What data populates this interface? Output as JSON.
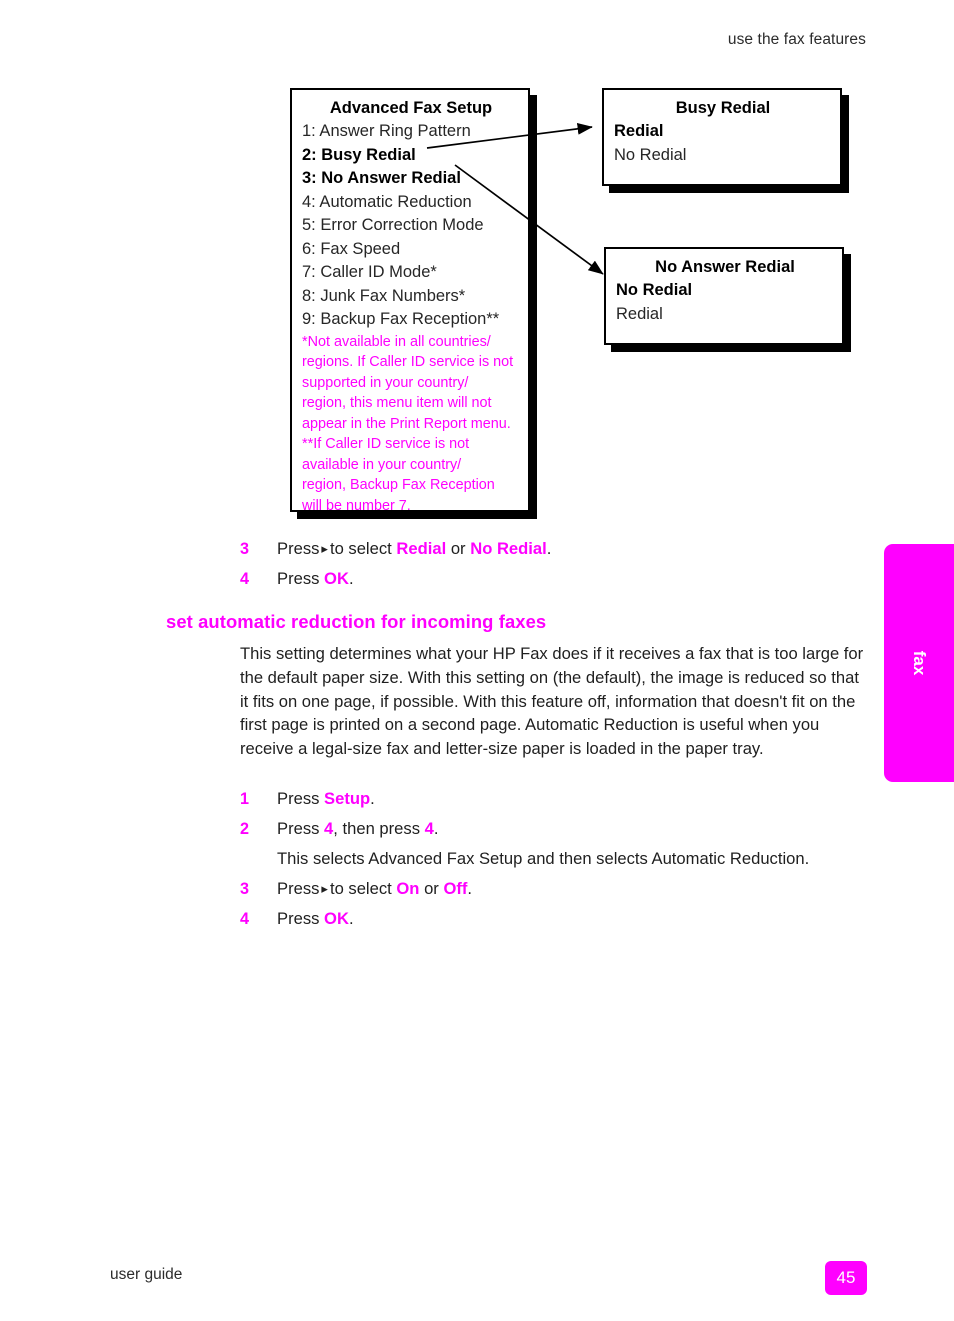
{
  "header": {
    "running_head": "use the fax features"
  },
  "diagram": {
    "advanced_box": {
      "title": "Advanced Fax Setup",
      "items": [
        {
          "label": "1: Answer Ring Pattern",
          "bold": false
        },
        {
          "label": "2: Busy Redial",
          "bold": true
        },
        {
          "label": "3: No Answer Redial",
          "bold": true
        },
        {
          "label": "4: Automatic Reduction",
          "bold": false
        },
        {
          "label": "5: Error Correction Mode",
          "bold": false
        },
        {
          "label": "6: Fax Speed",
          "bold": false
        },
        {
          "label": "7: Caller ID Mode*",
          "bold": false
        },
        {
          "label": "8: Junk Fax Numbers*",
          "bold": false
        },
        {
          "label": "9: Backup Fax Reception**",
          "bold": false
        }
      ],
      "footnotes": [
        "*Not available in all countries/",
        "regions. If Caller ID service is not",
        "supported in your country/",
        "region, this menu item will not",
        "appear in the Print Report menu.",
        "**If Caller ID service is not",
        "available in your country/",
        "region, Backup Fax Reception",
        "will be number 7."
      ]
    },
    "busy_redial_box": {
      "title": "Busy Redial",
      "option_selected": "Redial",
      "option_other": "No Redial"
    },
    "no_answer_redial_box": {
      "title": "No Answer Redial",
      "option_selected": "No Redial",
      "option_other": "Redial"
    }
  },
  "steps_top": [
    {
      "number": "3",
      "prefix": "Press",
      "arrow_glyph": "▸",
      "middle": "to select",
      "bold1": "Redial",
      "conj": "or",
      "bold2": "No Redial",
      "suffix": "."
    },
    {
      "number": "4",
      "prefix": "Press",
      "bold1": "OK",
      "suffix": "."
    }
  ],
  "section": {
    "heading": "set automatic reduction for incoming faxes",
    "paragraph": "This setting determines what your HP Fax does if it receives a fax that is too large for the default paper size. With this setting on (the default), the image is reduced so that it fits on one page, if possible. With this feature off, information that doesn't fit on the first page is printed on a second page. Automatic Reduction is useful when you receive a legal-size fax and letter-size paper is loaded in the paper tray."
  },
  "steps_bottom": [
    {
      "number": "1",
      "prefix": "Press",
      "bold1": "Setup",
      "suffix": "."
    },
    {
      "number": "2",
      "prefix": "Press",
      "bold1": "4",
      "conj": ", then press",
      "bold2": "4",
      "suffix": ".",
      "note": "This selects Advanced Fax Setup and then selects Automatic Reduction."
    },
    {
      "number": "3",
      "prefix": "Press",
      "arrow_glyph": "▸",
      "middle": "to select",
      "bold1": "On",
      "conj": "or",
      "bold2": "Off",
      "suffix": "."
    },
    {
      "number": "4",
      "prefix": "Press",
      "bold1": "OK",
      "suffix": "."
    }
  ],
  "thumb_tab": {
    "label": "fax"
  },
  "footer": {
    "left_label": "user guide",
    "page_number": "45"
  },
  "colors": {
    "accent_magenta": "#FF00FF",
    "body_text": "#1f1f1f",
    "box_border": "#000000"
  }
}
